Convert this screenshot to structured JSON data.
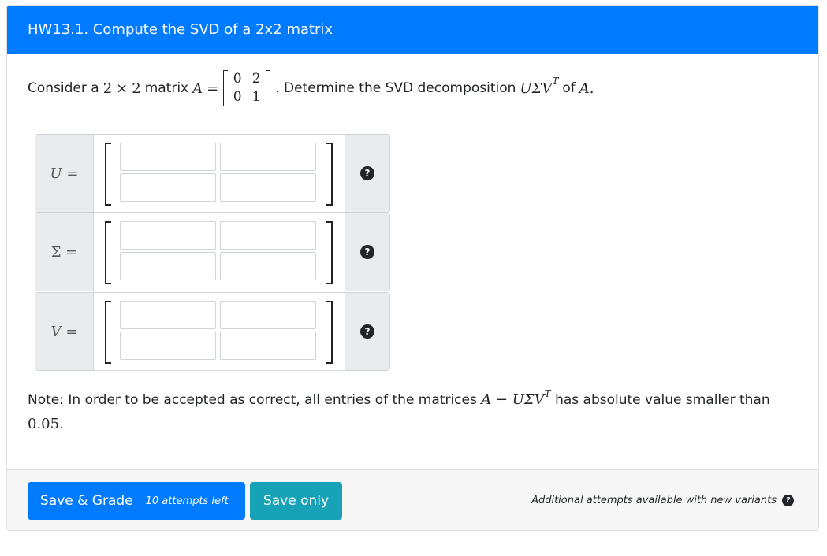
{
  "header": {
    "title": "HW13.1. Compute the SVD of a 2x2 matrix"
  },
  "question": {
    "prefix": "Consider a",
    "dim_2a": "2",
    "times": "×",
    "dim_2b": "2",
    "matrix_word": "matrix",
    "var_A": "A",
    "equals": "=",
    "matrix_A": {
      "r0c0": "0",
      "r0c1": "2",
      "r1c0": "0",
      "r1c1": "1"
    },
    "middle": ". Determine the SVD decomposition",
    "usv": "UΣV",
    "sup_T": "T",
    "of": "of",
    "var_A_end": "A."
  },
  "matrices": [
    {
      "label": "U =",
      "help_icon": "question-circle-icon",
      "cells": [
        "",
        "",
        "",
        ""
      ]
    },
    {
      "label": "Σ =",
      "help_icon": "question-circle-icon",
      "cells": [
        "",
        "",
        "",
        ""
      ]
    },
    {
      "label": "V =",
      "help_icon": "question-circle-icon",
      "cells": [
        "",
        "",
        "",
        ""
      ]
    }
  ],
  "note": {
    "text1": "Note: In order to be accepted as correct, all entries of the matrices",
    "expr": "A − UΣV",
    "sup_T": "T",
    "text2": "has absolute value smaller than",
    "value": "0.05",
    "end": "."
  },
  "footer": {
    "save_grade_label": "Save & Grade",
    "attempts_left": "10 attempts left",
    "save_only_label": "Save only",
    "additional_text": "Additional attempts available with new variants"
  },
  "colors": {
    "primary": "#007bff",
    "info": "#17a2b8",
    "addon_bg": "#e9ecef"
  }
}
